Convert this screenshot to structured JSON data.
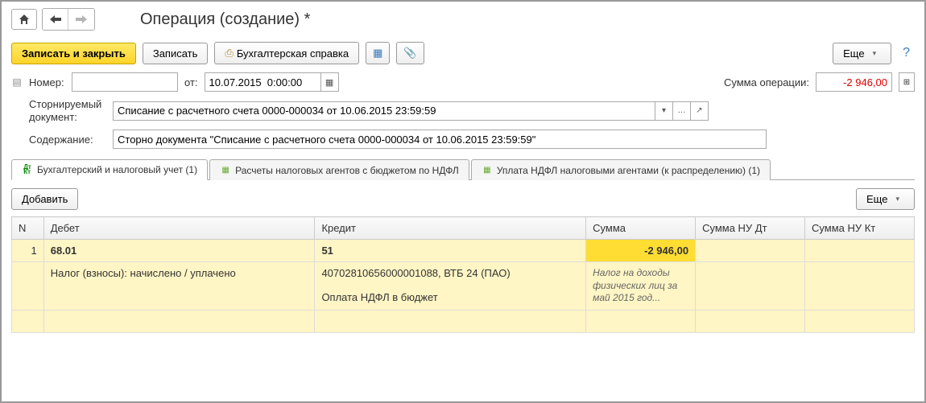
{
  "title": "Операция (создание) *",
  "toolbar": {
    "save_close": "Записать и закрыть",
    "save": "Записать",
    "report": "Бухгалтерская справка",
    "more": "Еще"
  },
  "fields": {
    "number_label": "Номер:",
    "number_value": "",
    "from_label": "от:",
    "date_value": "10.07.2015  0:00:00",
    "sum_label": "Сумма операции:",
    "sum_value": "-2 946,00",
    "storno_label_1": "Сторнируемый",
    "storno_label_2": "документ:",
    "storno_value": "Списание с расчетного счета 0000-000034 от 10.06.2015 23:59:59",
    "content_label": "Содержание:",
    "content_value": "Сторно документа \"Списание с расчетного счета 0000-000034 от 10.06.2015 23:59:59\""
  },
  "tabs": [
    {
      "label": "Бухгалтерский и налоговый учет (1)"
    },
    {
      "label": "Расчеты налоговых агентов с бюджетом по НДФЛ"
    },
    {
      "label": "Уплата НДФЛ налоговыми агентами (к распределению) (1)"
    }
  ],
  "table_toolbar": {
    "add": "Добавить",
    "more": "Еще"
  },
  "columns": {
    "n": "N",
    "debit": "Дебет",
    "credit": "Кредит",
    "sum": "Сумма",
    "sum_nu_dt": "Сумма НУ Дт",
    "sum_nu_kt": "Сумма НУ Кт"
  },
  "rows": [
    {
      "n": "1",
      "debit": "68.01",
      "credit": "51",
      "sum": "-2 946,00",
      "debit_analytic": "Налог (взносы): начислено / уплачено",
      "credit_analytic1": "40702810656000001088, ВТБ 24 (ПАО)",
      "credit_analytic2": "Оплата НДФЛ в бюджет",
      "note": "Налог на доходы физических лиц за май 2015 год..."
    }
  ]
}
